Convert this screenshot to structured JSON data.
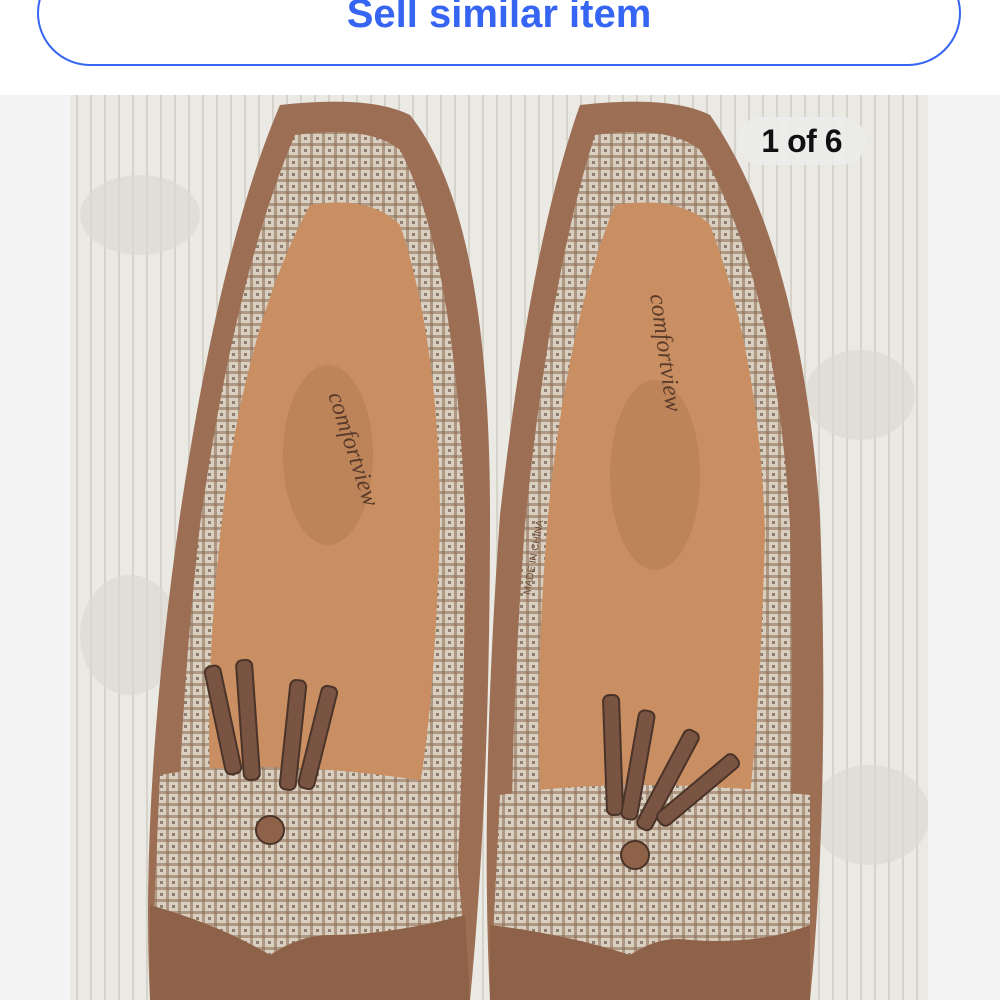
{
  "sell_button": {
    "label": "Sell similar item",
    "color": "#3665f3"
  },
  "gallery": {
    "counter": "1 of 6",
    "insole_brand": "comfortview",
    "insole_label": "MADE IN CHINA"
  }
}
